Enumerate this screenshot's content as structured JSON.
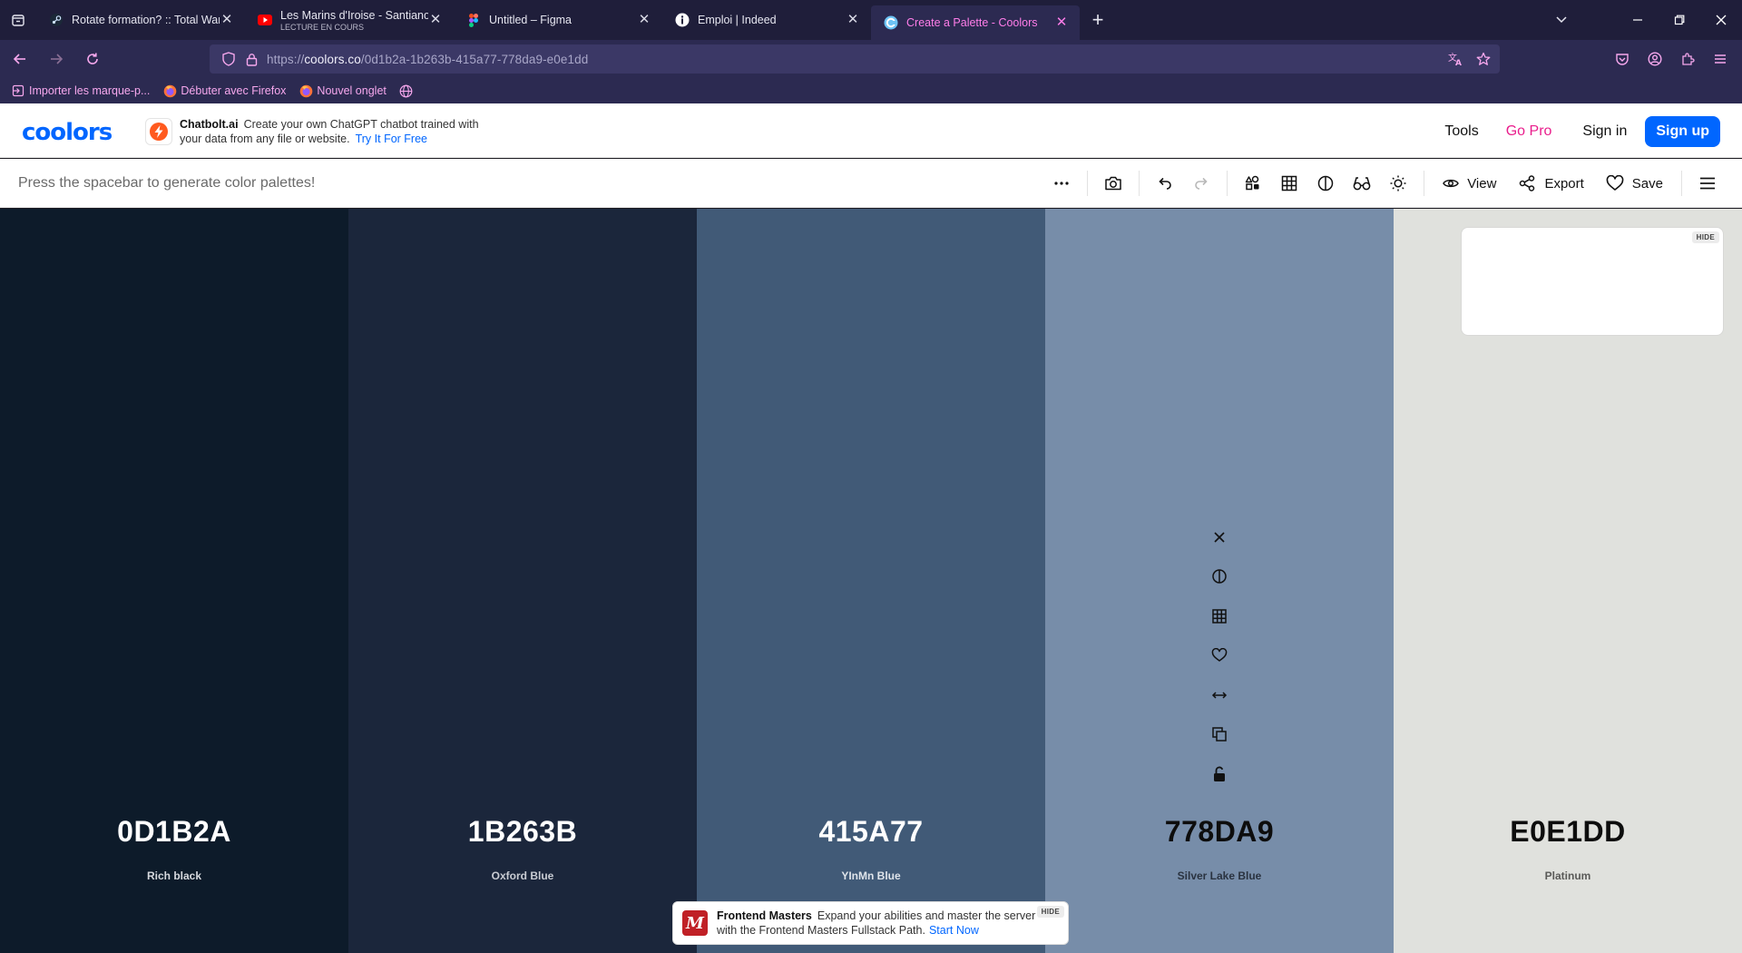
{
  "browser": {
    "tabs": [
      {
        "title": "Rotate formation? :: Total War: WARHAMMER III",
        "subtitle": "",
        "icon": "steam-icon",
        "active": false
      },
      {
        "title": "Les Marins d'Iroise - Santiano (Extrait)",
        "subtitle": "LECTURE EN COURS",
        "icon": "youtube-icon",
        "active": false
      },
      {
        "title": "Untitled – Figma",
        "subtitle": "",
        "icon": "figma-icon",
        "active": false
      },
      {
        "title": "Emploi | Indeed",
        "subtitle": "",
        "icon": "indeed-icon",
        "active": false
      },
      {
        "title": "Create a Palette - Coolors",
        "subtitle": "",
        "icon": "coolors-icon",
        "active": true
      }
    ],
    "url_prefix": "https://",
    "url_host": "coolors.co",
    "url_path": "/0d1b2a-1b263b-415a77-778da9-e0e1dd",
    "bookmarks": [
      {
        "label": "Importer les marque-p...",
        "icon": "import-icon"
      },
      {
        "label": "Débuter avec Firefox",
        "icon": "firefox-icon"
      },
      {
        "label": "Nouvel onglet",
        "icon": "firefox-icon"
      },
      {
        "label": "",
        "icon": "globe-icon"
      }
    ]
  },
  "header": {
    "logo": "coolors",
    "ad": {
      "brand": "Chatbolt.ai",
      "text": "Create your own ChatGPT chatbot trained with your data from any file or website.",
      "cta": "Try It For Free"
    },
    "nav": {
      "tools": "Tools",
      "go_pro": "Go Pro",
      "sign_in": "Sign in",
      "sign_up": "Sign up"
    }
  },
  "toolbar": {
    "hint": "Press the spacebar to generate color palettes!",
    "view": "View",
    "export": "Export",
    "save": "Save"
  },
  "palette": [
    {
      "hex": "0D1B2A",
      "name": "Rich black",
      "color": "#0d1b2a",
      "text_color": "#ffffff",
      "name_color": "#d6d9de"
    },
    {
      "hex": "1B263B",
      "name": "Oxford Blue",
      "color": "#1b263b",
      "text_color": "#ffffff",
      "name_color": "#c9ccd3"
    },
    {
      "hex": "415A77",
      "name": "YInMn Blue",
      "color": "#415a77",
      "text_color": "#ffffff",
      "name_color": "#dfe4ea"
    },
    {
      "hex": "778DA9",
      "name": "Silver Lake Blue",
      "color": "#778da9",
      "text_color": "#0d0d0d",
      "name_color": "#2a3340"
    },
    {
      "hex": "E0E1DD",
      "name": "Platinum",
      "color": "#e0e1dd",
      "text_color": "#0d0d0d",
      "name_color": "#5a5a58"
    }
  ],
  "ads": {
    "card_hide": "HIDE",
    "fm": {
      "brand": "Frontend Masters",
      "text": "Expand your abilities and master the server with the Frontend Masters Fullstack Path.",
      "cta": "Start Now",
      "hide": "HIDE"
    }
  }
}
